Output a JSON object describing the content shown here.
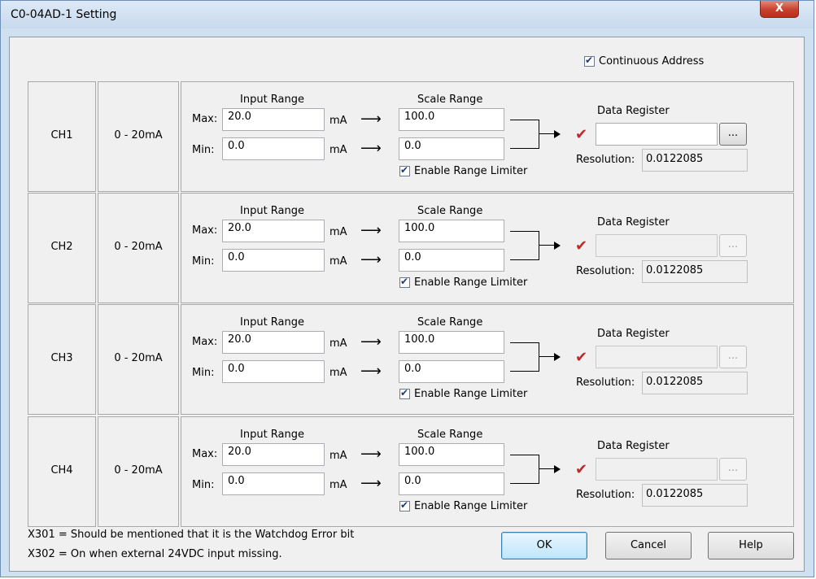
{
  "window": {
    "title": "C0-04AD-1 Setting",
    "close_glyph": "X"
  },
  "continuous_address": {
    "label": "Continuous Address",
    "checked": true
  },
  "labels": {
    "input_range": "Input Range",
    "scale_range": "Scale Range",
    "max": "Max:",
    "min": "Min:",
    "unit": "mA",
    "enable_limiter": "Enable Range Limiter",
    "data_register": "Data Register",
    "resolution": "Resolution:",
    "browse": "..."
  },
  "channels": [
    {
      "name": "CH1",
      "range": "0 - 20mA",
      "input_max": "20.0",
      "input_min": "0.0",
      "scale_max": "100.0",
      "scale_min": "0.0",
      "limiter_checked": true,
      "data_register": "",
      "data_register_enabled": true,
      "resolution": "0.0122085"
    },
    {
      "name": "CH2",
      "range": "0 - 20mA",
      "input_max": "20.0",
      "input_min": "0.0",
      "scale_max": "100.0",
      "scale_min": "0.0",
      "limiter_checked": true,
      "data_register": "",
      "data_register_enabled": false,
      "resolution": "0.0122085"
    },
    {
      "name": "CH3",
      "range": "0 - 20mA",
      "input_max": "20.0",
      "input_min": "0.0",
      "scale_max": "100.0",
      "scale_min": "0.0",
      "limiter_checked": true,
      "data_register": "",
      "data_register_enabled": false,
      "resolution": "0.0122085"
    },
    {
      "name": "CH4",
      "range": "0 - 20mA",
      "input_max": "20.0",
      "input_min": "0.0",
      "scale_max": "100.0",
      "scale_min": "0.0",
      "limiter_checked": true,
      "data_register": "",
      "data_register_enabled": false,
      "resolution": "0.0122085"
    }
  ],
  "footnotes": [
    "X301 = Should be mentioned that it is the Watchdog Error bit",
    "X302 = On when external 24VDC input missing."
  ],
  "buttons": {
    "ok": "OK",
    "cancel": "Cancel",
    "help": "Help"
  },
  "colors": {
    "titlebar": "#cfe0f1",
    "close": "#c8402c",
    "check_red": "#c0282a"
  }
}
